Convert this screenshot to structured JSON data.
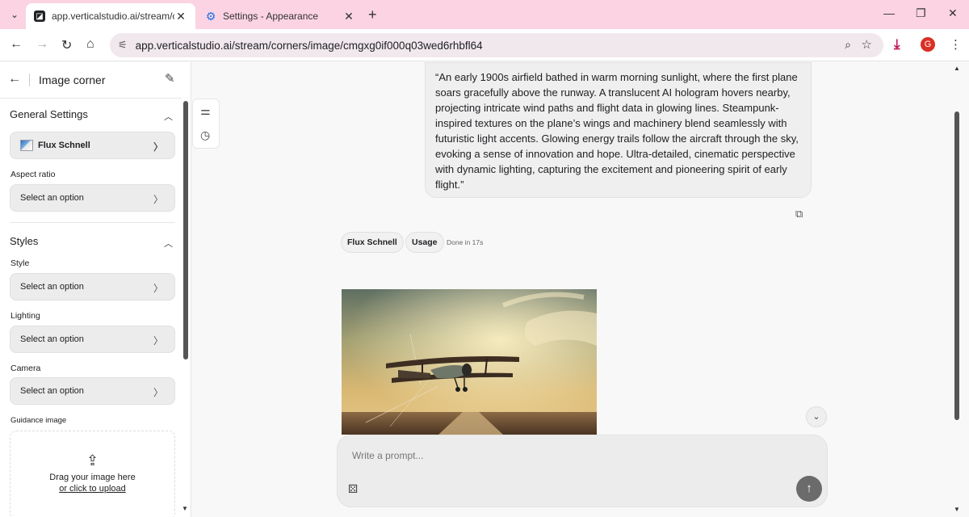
{
  "browser": {
    "tabs": [
      {
        "title": "app.verticalstudio.ai/stream/cor",
        "active": true
      },
      {
        "title": "Settings - Appearance",
        "active": false
      }
    ],
    "url": "app.verticalstudio.ai/stream/corners/image/cmgxg0if000q03wed6rhbfl64",
    "profile_initial": "G",
    "accent_color": "#fbd3e3"
  },
  "sidebar": {
    "title": "Image corner",
    "general_settings": {
      "heading": "General Settings",
      "model": "Flux Schnell",
      "aspect_ratio_label": "Aspect ratio",
      "aspect_ratio_value": "Select an option"
    },
    "styles": {
      "heading": "Styles",
      "style_label": "Style",
      "style_value": "Select an option",
      "lighting_label": "Lighting",
      "lighting_value": "Select an option",
      "camera_label": "Camera",
      "camera_value": "Select an option"
    },
    "guidance": {
      "label": "Guidance image",
      "drag_text": "Drag your image here",
      "click_text": "or click to upload"
    }
  },
  "chat": {
    "prompt_text": "“An early 1900s airfield bathed in warm morning sunlight, where the first plane soars gracefully above the runway. A translucent AI hologram hovers nearby, projecting intricate wind paths and flight data in glowing lines. Steampunk-inspired textures on the plane’s wings and machinery blend seamlessly with futuristic light accents. Glowing energy trails follow the aircraft through the sky, evoking a sense of innovation and hope. Ultra-detailed, cinematic perspective with dynamic lighting, capturing the excitement and pioneering spirit of early flight.”",
    "model_chip": "Flux Schnell",
    "usage_chip": "Usage",
    "status": "Done in 17s"
  },
  "composer": {
    "placeholder": "Write a prompt..."
  }
}
